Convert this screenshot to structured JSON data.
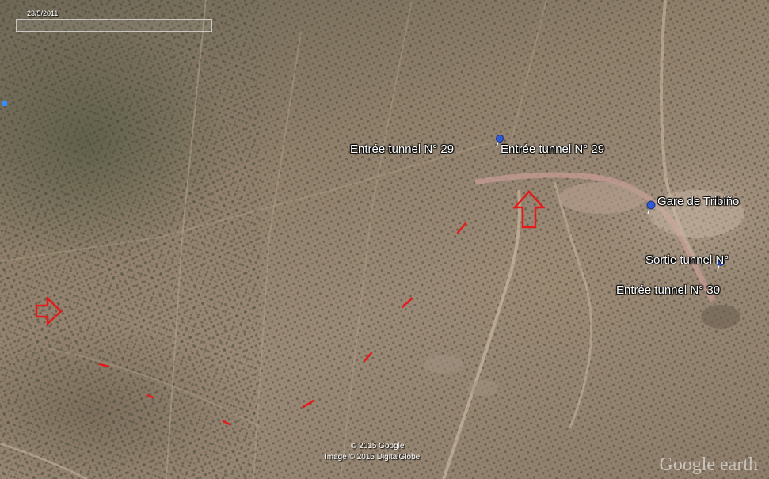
{
  "map": {
    "date": "23/5/2011",
    "copyright_line1": "© 2015 Google",
    "copyright_line2": "Image © 2015 DigitalGlobe",
    "logo": "Google earth"
  },
  "places": [
    {
      "name": "tunnel-29-label-left",
      "text": "Entrée tunnel N° 29"
    },
    {
      "name": "tunnel-29-label-right",
      "text": "Entrée tunnel N° 29"
    },
    {
      "name": "gare-label",
      "text": "Gare de Tribiño"
    },
    {
      "name": "sortie-label",
      "text": "Sortie tunnel N°"
    },
    {
      "name": "tunnel-30-label",
      "text": "Entrée tunnel N° 30"
    }
  ],
  "colors": {
    "annotation": "#e8191a",
    "pin": "#2f5bd8",
    "track": "#c79b94"
  },
  "icons": {
    "pin": "pushpin-icon",
    "arrow": "outline-arrow-icon"
  }
}
